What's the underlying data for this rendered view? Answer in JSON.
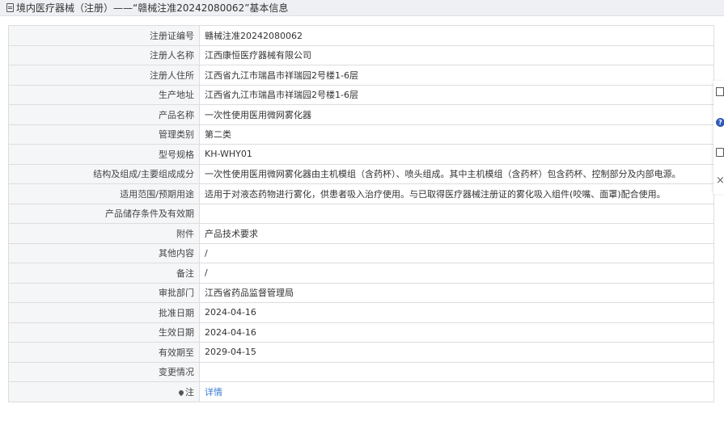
{
  "header": {
    "title": "境内医疗器械（注册）——“赣械注准20242080062”基本信息"
  },
  "rows": [
    {
      "label": "注册证编号",
      "value": "赣械注准20242080062"
    },
    {
      "label": "注册人名称",
      "value": "江西康恒医疗器械有限公司"
    },
    {
      "label": "注册人住所",
      "value": "江西省九江市瑞昌市祥瑞园2号楼1-6层"
    },
    {
      "label": "生产地址",
      "value": "江西省九江市瑞昌市祥瑞园2号楼1-6层"
    },
    {
      "label": "产品名称",
      "value": "一次性使用医用微网雾化器"
    },
    {
      "label": "管理类别",
      "value": "第二类"
    },
    {
      "label": "型号规格",
      "value": "KH-WHY01"
    },
    {
      "label": "结构及组成/主要组成成分",
      "value": "一次性使用医用微网雾化器由主机模组（含药杯）、喷头组成。其中主机模组（含药杯）包含药杯、控制部分及内部电源。"
    },
    {
      "label": "适用范围/预期用途",
      "value": "适用于对液态药物进行雾化，供患者吸入治疗使用。与已取得医疗器械注册证的雾化吸入组件(咬嘴、面罩)配合使用。"
    },
    {
      "label": "产品储存条件及有效期",
      "value": ""
    },
    {
      "label": "附件",
      "value": "产品技术要求"
    },
    {
      "label": "其他内容",
      "value": "/"
    },
    {
      "label": "备注",
      "value": "/"
    },
    {
      "label": "审批部门",
      "value": "江西省药品监督管理局"
    },
    {
      "label": "批准日期",
      "value": "2024-04-16"
    },
    {
      "label": "生效日期",
      "value": "2024-04-16"
    },
    {
      "label": "有效期至",
      "value": "2029-04-15"
    },
    {
      "label": "变更情况",
      "value": ""
    }
  ],
  "note": {
    "label": "注",
    "link": "详情"
  },
  "sidebar": {
    "icons": [
      "edit-icon",
      "help-icon",
      "print-icon",
      "close-icon"
    ],
    "help_glyph": "?"
  }
}
